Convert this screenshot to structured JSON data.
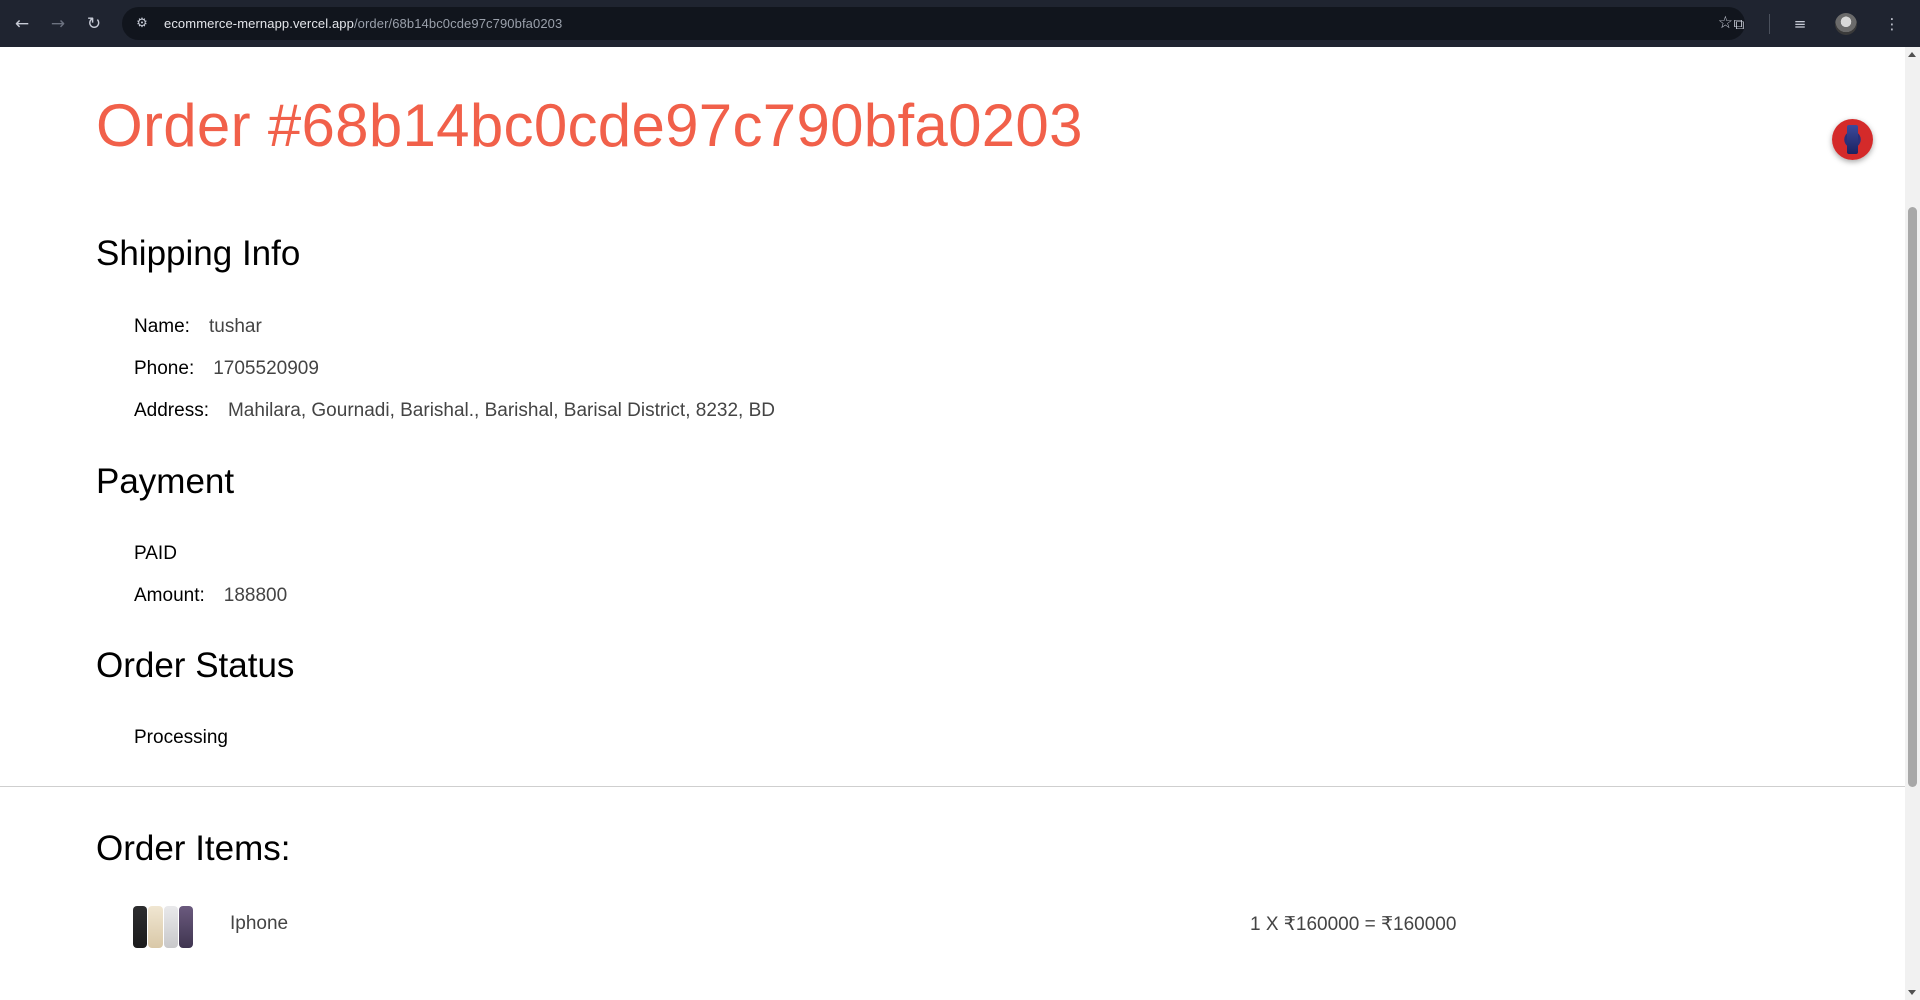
{
  "browser": {
    "url_host": "ecommerce-mernapp.vercel.app",
    "url_path": "/order/68b14bc0cde97c790bfa0203",
    "icons": [
      "back-arrow-icon",
      "forward-arrow-icon",
      "reload-icon",
      "site-info-icon",
      "bookmark-star-icon",
      "extensions-icon",
      "media-controls-icon",
      "profile-avatar-icon",
      "more-menu-icon"
    ]
  },
  "order": {
    "title": "Order #68b14bc0cde97c790bfa0203"
  },
  "shipping": {
    "heading": "Shipping Info",
    "name_label": "Name:",
    "name_value": "tushar",
    "phone_label": "Phone:",
    "phone_value": "1705520909",
    "address_label": "Address:",
    "address_value": "Mahilara, Gournadi, Barishal., Barishal, Barisal District, 8232, BD"
  },
  "payment": {
    "heading": "Payment",
    "status": "PAID",
    "amount_label": "Amount:",
    "amount_value": "188800"
  },
  "order_status": {
    "heading": "Order Status",
    "value": "Processing"
  },
  "order_items": {
    "heading": "Order Items:",
    "items": [
      {
        "name": "Iphone",
        "price_text": "1 X ₹160000 = ₹160000"
      }
    ]
  }
}
